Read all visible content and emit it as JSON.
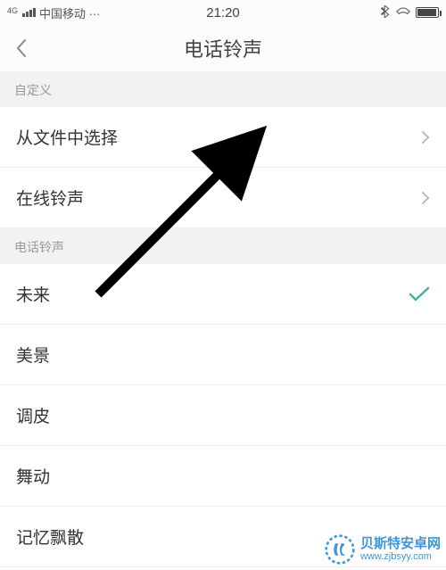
{
  "status_bar": {
    "network_type": "4G",
    "carrier": "中国移动 ···",
    "time": "21:20"
  },
  "header": {
    "title": "电话铃声"
  },
  "sections": {
    "custom": {
      "header": "自定义"
    },
    "ringtones": {
      "header": "电话铃声"
    }
  },
  "custom_items": {
    "from_file": "从文件中选择",
    "online": "在线铃声"
  },
  "ringtone_items": {
    "r0": "未来",
    "r1": "美景",
    "r2": "调皮",
    "r3": "舞动",
    "r4": "记忆飘散"
  },
  "selected_ringtone": "未来",
  "watermark": {
    "title": "贝斯特安卓网",
    "url": "www.zjbsyy.com"
  }
}
